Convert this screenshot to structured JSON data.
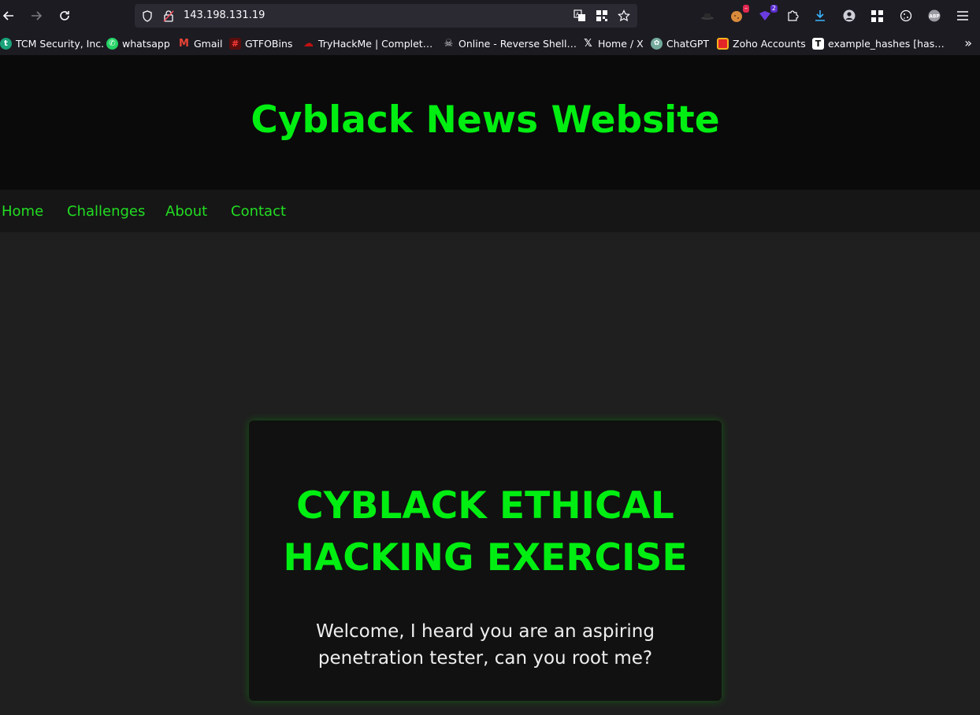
{
  "browser": {
    "url": "143.198.131.19",
    "extension_badge": "2",
    "bookmarks": [
      {
        "label": "TCM Security, Inc.",
        "icon": "tcm-icon"
      },
      {
        "label": "whatsapp",
        "icon": "whatsapp-icon"
      },
      {
        "label": "Gmail",
        "icon": "gmail-icon"
      },
      {
        "label": "GTFOBins",
        "icon": "gtfobins-icon"
      },
      {
        "label": "TryHackMe | Complet…",
        "icon": "tryhackme-icon"
      },
      {
        "label": "Online - Reverse Shell…",
        "icon": "skull-icon"
      },
      {
        "label": "Home / X",
        "icon": "x-icon"
      },
      {
        "label": "ChatGPT",
        "icon": "chatgpt-icon"
      },
      {
        "label": "Zoho Accounts",
        "icon": "zoho-icon"
      },
      {
        "label": "example_hashes [has…",
        "icon": "hashcat-icon"
      }
    ]
  },
  "site": {
    "title": "Cyblack News Website",
    "nav": [
      "Home",
      "Challenges",
      "About",
      "Contact"
    ],
    "card": {
      "title": "CYBLACK ETHICAL HACKING EXERCISE",
      "text": "Welcome, I heard you are an aspiring penetration tester, can you root me?"
    }
  },
  "colors": {
    "accent_green": "#00ee11",
    "page_background": "#1f1f1f",
    "header_background": "#0a0a0a",
    "card_background": "#111111"
  }
}
